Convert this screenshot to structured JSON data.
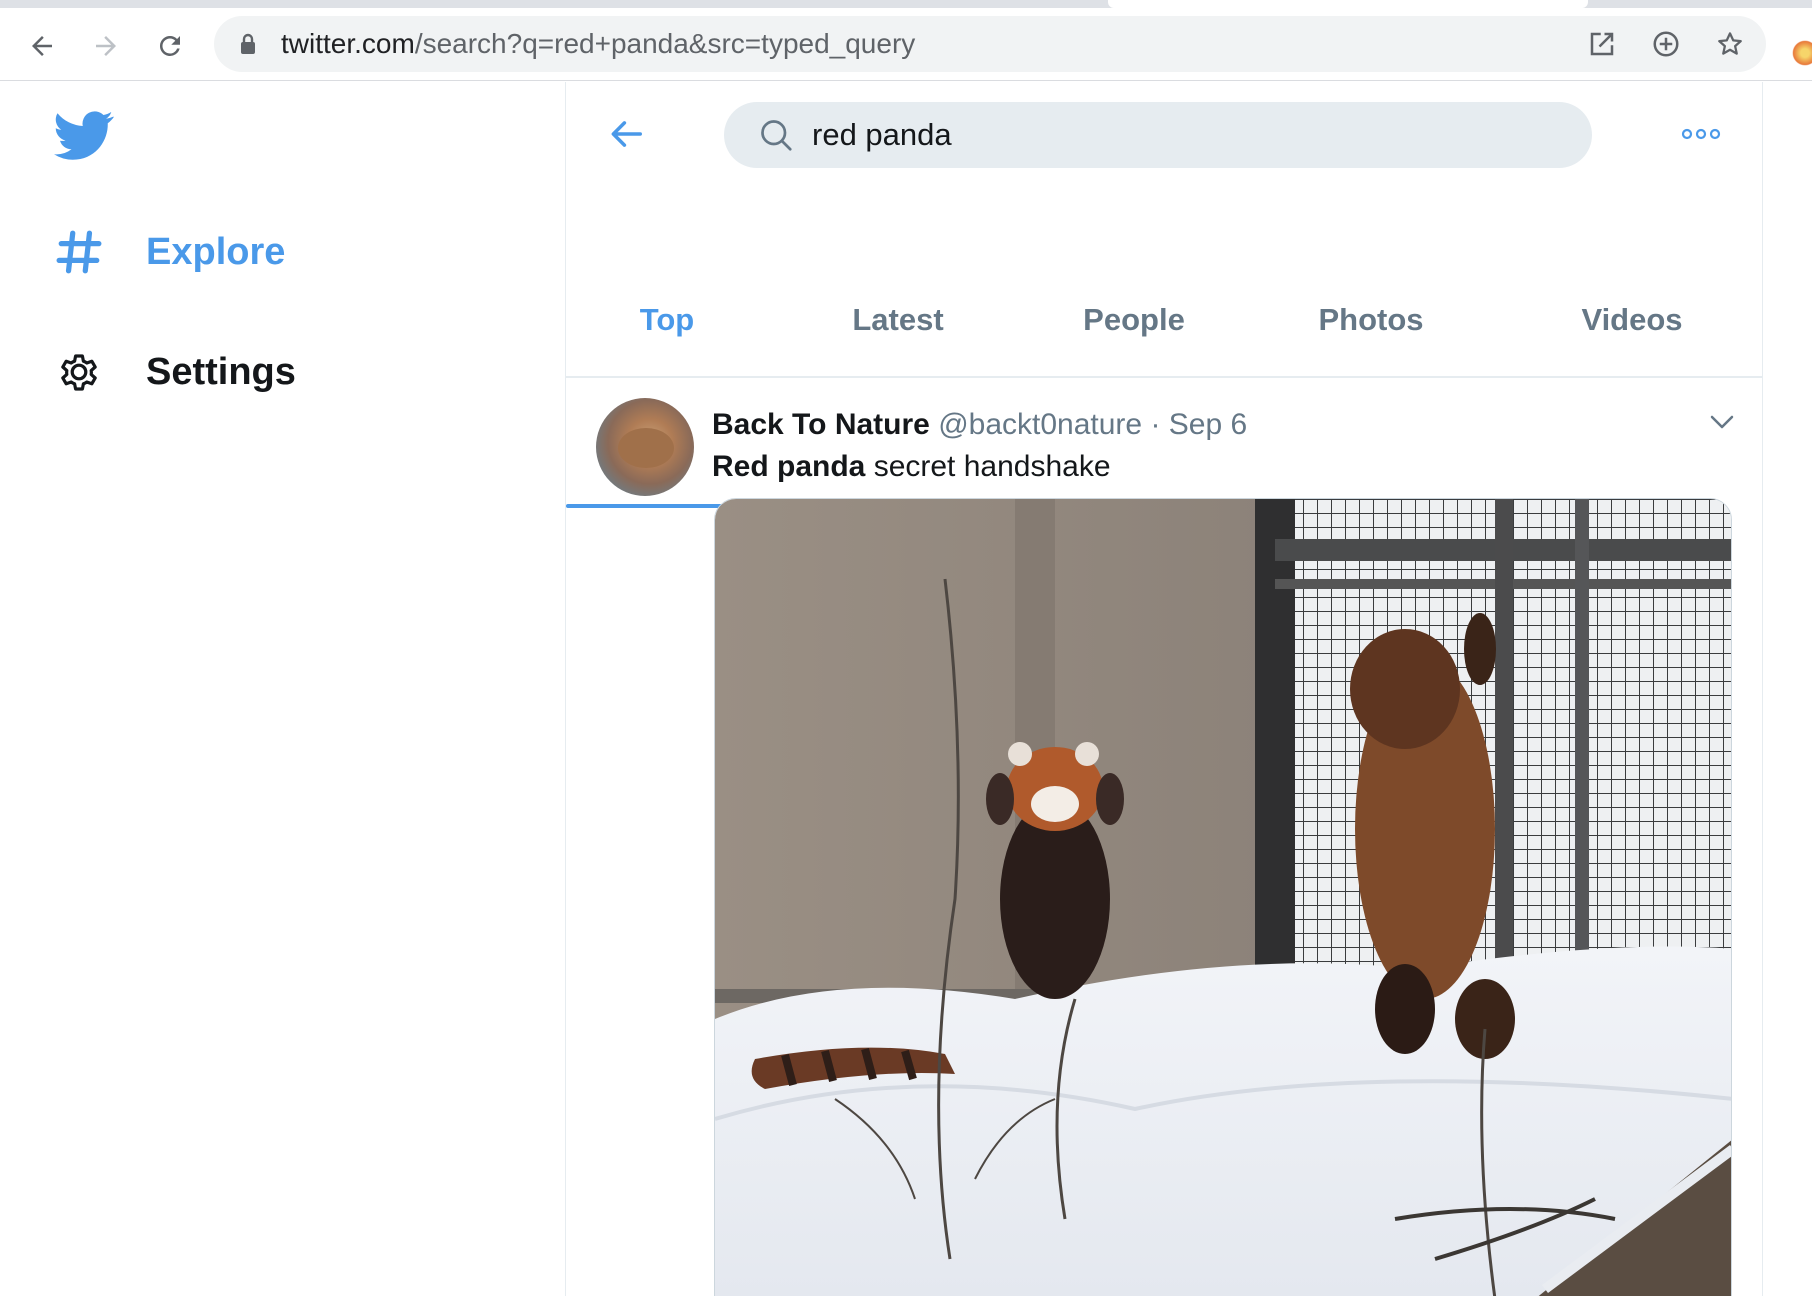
{
  "browser": {
    "url_host": "twitter.com",
    "url_path": "/search?q=red+panda&src=typed_query"
  },
  "sidebar": {
    "items": [
      {
        "label": "Explore",
        "icon": "hashtag-icon",
        "active": true
      },
      {
        "label": "Settings",
        "icon": "gear-icon",
        "active": false
      }
    ]
  },
  "search": {
    "value": "red panda"
  },
  "tabs": [
    {
      "label": "Top",
      "active": true
    },
    {
      "label": "Latest",
      "active": false
    },
    {
      "label": "People",
      "active": false
    },
    {
      "label": "Photos",
      "active": false
    },
    {
      "label": "Videos",
      "active": false
    }
  ],
  "tweet": {
    "display_name": "Back To Nature",
    "handle": "@backt0nature",
    "separator": "·",
    "date": "Sep 6",
    "text_bold": "Red panda",
    "text_rest": " secret handshake"
  },
  "colors": {
    "accent": "#4a99e9",
    "text": "#14171a",
    "secondary_text": "#657786",
    "search_bg": "#e6ecf0"
  }
}
